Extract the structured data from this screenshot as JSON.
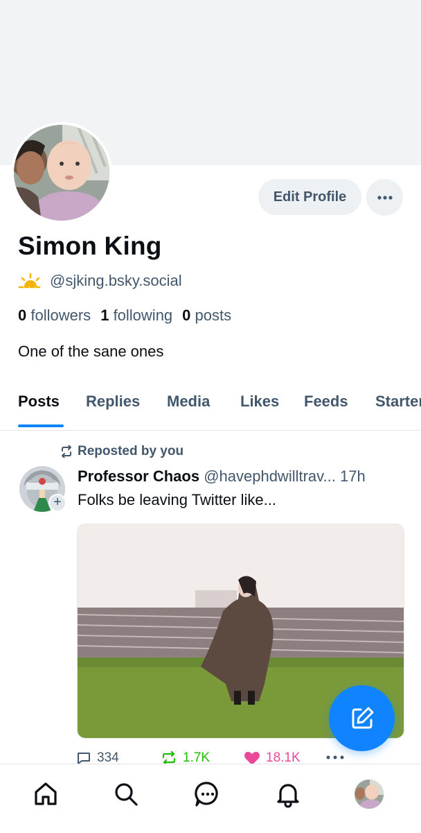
{
  "profile": {
    "display_name": "Simon King",
    "handle": "@sjking.bsky.social",
    "followers_count": "0",
    "followers_label": "followers",
    "following_count": "1",
    "following_label": "following",
    "posts_count": "0",
    "posts_label": "posts",
    "bio": "One of the sane ones",
    "edit_profile_label": "Edit Profile"
  },
  "tabs": [
    {
      "label": "Posts",
      "active": true
    },
    {
      "label": "Replies"
    },
    {
      "label": "Media"
    },
    {
      "label": "Likes"
    },
    {
      "label": "Feeds"
    },
    {
      "label": "Starter Packs"
    }
  ],
  "post": {
    "repost_label": "Reposted by you",
    "author_name": "Professor Chaos",
    "author_handle": "@havephdwilltrav...",
    "time": "17h",
    "text": "Folks be leaving Twitter like...",
    "replies": "334",
    "reposts": "1.7K",
    "likes": "18.1K"
  },
  "colors": {
    "accent": "#1083fe",
    "muted_text": "#42576c",
    "like": "#ec4899",
    "repost": "#20bc07"
  },
  "icons": {
    "nav": [
      "home-icon",
      "search-icon",
      "chat-icon",
      "bell-icon",
      "profile-avatar"
    ],
    "fab": "compose-icon"
  }
}
